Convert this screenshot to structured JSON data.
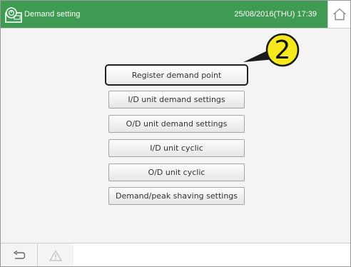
{
  "header": {
    "title": "Demand setting",
    "datetime": "25/08/2016(THU) 17:39",
    "bar_color": "#3f9a52",
    "app_icon": "remote-controller-icon",
    "home_icon": "home-icon"
  },
  "menu": {
    "buttons": [
      {
        "label": "Register demand point",
        "highlighted": true
      },
      {
        "label": "I/D unit demand settings",
        "highlighted": false
      },
      {
        "label": "O/D unit demand settings",
        "highlighted": false
      },
      {
        "label": "I/D unit cyclic",
        "highlighted": false
      },
      {
        "label": "O/D unit cyclic",
        "highlighted": false
      },
      {
        "label": "Demand/peak shaving settings",
        "highlighted": false
      }
    ]
  },
  "callout": {
    "number": "2",
    "color": "#f5e81c"
  },
  "footer": {
    "back_icon": "back-arrow-icon",
    "alarm_icon": "warning-icon"
  }
}
